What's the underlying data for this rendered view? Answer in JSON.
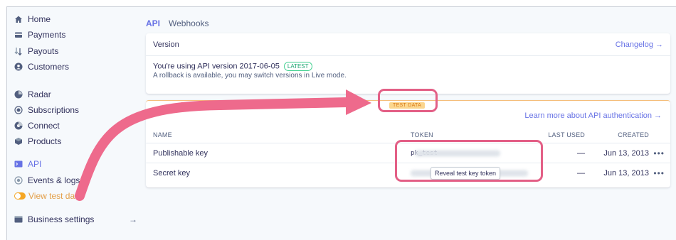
{
  "sidebar": {
    "items": [
      {
        "label": "Home"
      },
      {
        "label": "Payments"
      },
      {
        "label": "Payouts"
      },
      {
        "label": "Customers"
      },
      {
        "label": "Radar"
      },
      {
        "label": "Subscriptions"
      },
      {
        "label": "Connect"
      },
      {
        "label": "Products"
      },
      {
        "label": "API"
      },
      {
        "label": "Events & logs"
      },
      {
        "label": "View test data"
      },
      {
        "label": "Business settings",
        "arrow": "→"
      }
    ]
  },
  "tabs": [
    {
      "label": "API",
      "active": true
    },
    {
      "label": "Webhooks"
    }
  ],
  "version_card": {
    "title": "Version",
    "changelog_link": "Changelog →",
    "line1": "You're using API version 2017-06-05",
    "badge": "LATEST",
    "line2": "A rollback is available, you may switch versions in Live mode."
  },
  "keys_card": {
    "test_badge": "TEST DATA",
    "auth_link": "Learn more about API authentication →",
    "columns": {
      "name": "NAME",
      "token": "TOKEN",
      "last_used": "LAST USED",
      "created": "CREATED"
    },
    "rows": [
      {
        "name": "Publishable key",
        "token": "pk_test",
        "last_used": "—",
        "created": "Jun 13, 2013",
        "more": "•••"
      },
      {
        "name": "Secret key",
        "token": "sk_test",
        "last_used": "—",
        "created": "Jun 13, 2013",
        "more": "•••"
      }
    ],
    "tooltip": "Reveal test key token"
  },
  "colors": {
    "accent": "#6772e5",
    "test_orange": "#f5a623",
    "annotation_pink": "#e35f86"
  }
}
